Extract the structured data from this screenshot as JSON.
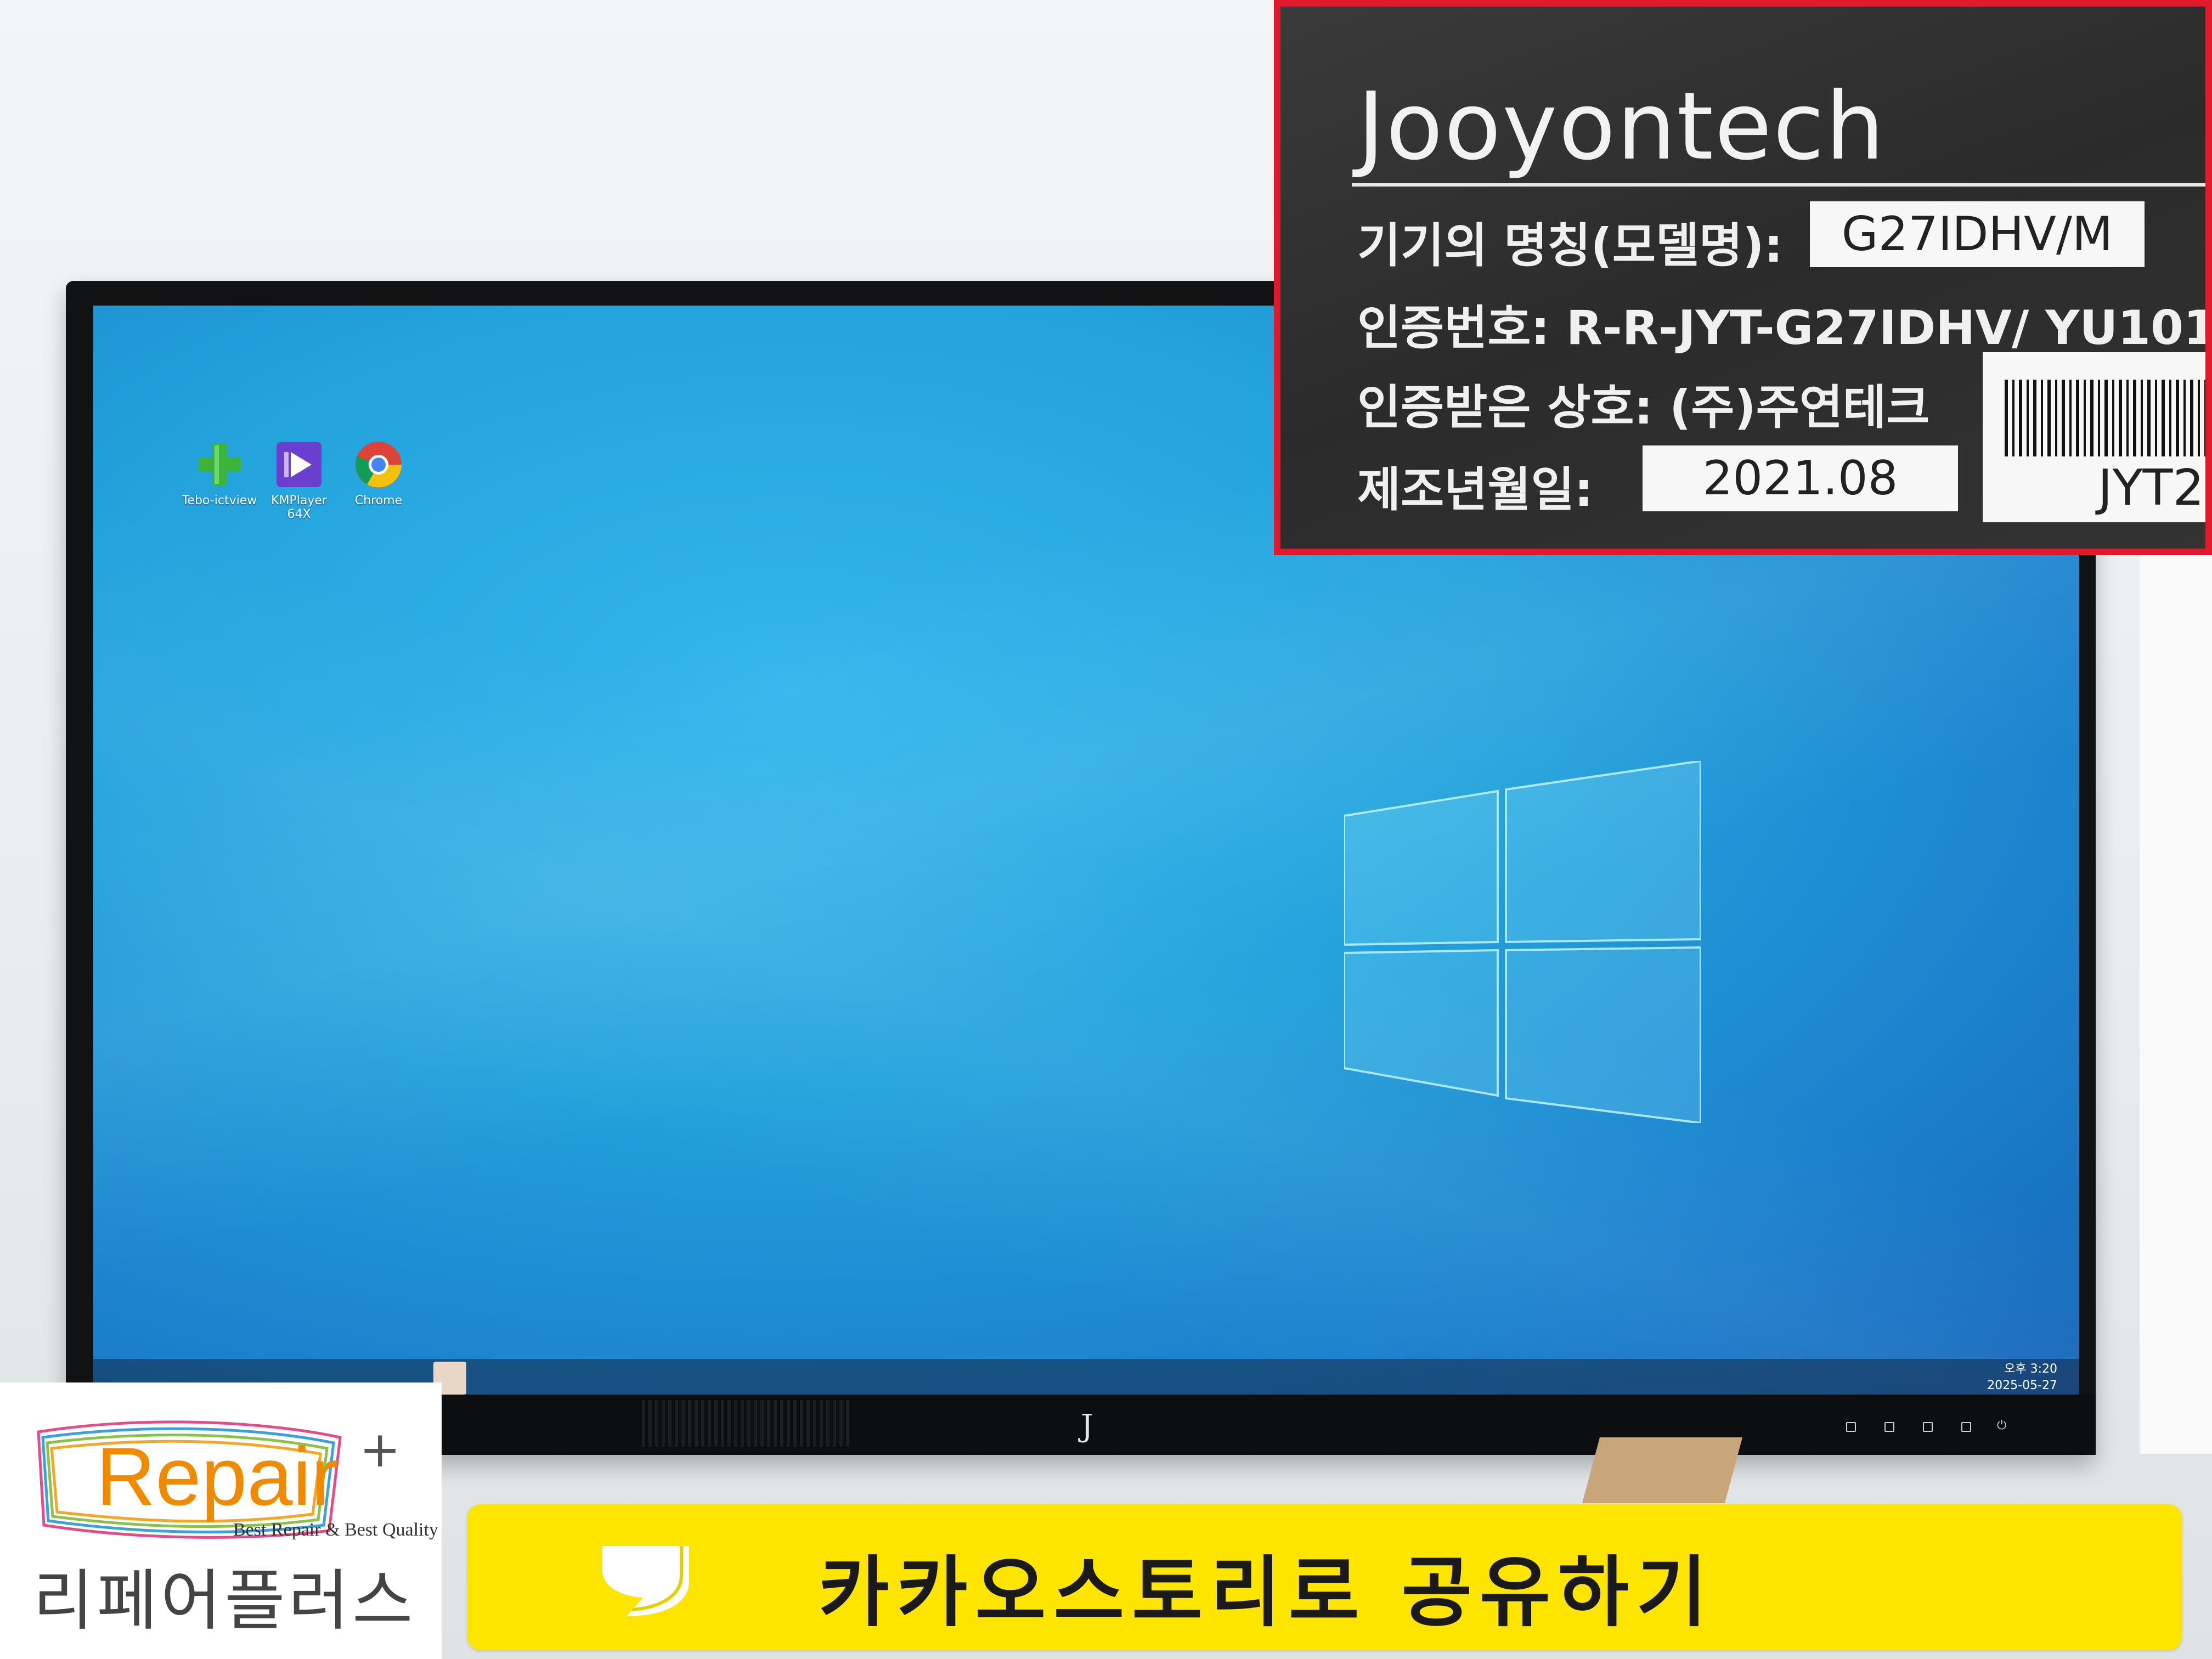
{
  "desktop": {
    "icons": [
      {
        "label": "Tebo-ictview",
        "icon": "plus-app-icon"
      },
      {
        "label": "KMPlayer 64X",
        "icon": "kmplayer-icon"
      },
      {
        "label": "Chrome",
        "icon": "chrome-icon"
      }
    ],
    "taskbar": {
      "time": "오후 3:20",
      "date": "2025-05-27"
    }
  },
  "monitor": {
    "bezel_logo": "J"
  },
  "label_inset": {
    "brand": "Jooyontech",
    "rows": [
      {
        "label": "기기의 명칭(모델명):",
        "value": "G27IDHV/M"
      },
      {
        "label": "인증번호: R-R-JYT-G27IDHV/ YU101",
        "value": ""
      },
      {
        "label": "인증받은 상호: (주)주연테크",
        "value": ""
      },
      {
        "label": "제조년월일:",
        "value": "2021.08"
      }
    ],
    "barcode_text": "JYT2",
    "accent_color": "#e0192d"
  },
  "branding": {
    "logo_word": "Repair",
    "logo_plus": "+",
    "tagline": "Best Repair & Best Quality",
    "korean_name": "리페어플러스"
  },
  "share_button": {
    "label": "카카오스토리로 공유하기",
    "color": "#fee500",
    "icon": "kakaostory-icon"
  }
}
